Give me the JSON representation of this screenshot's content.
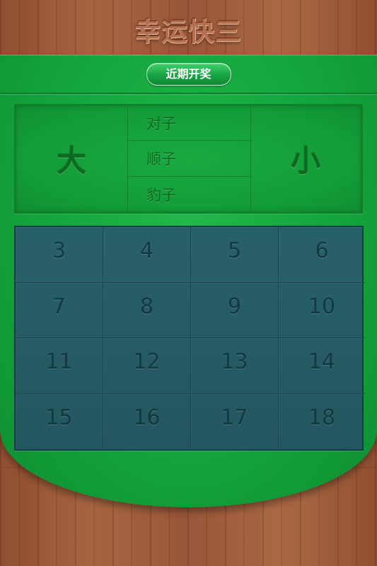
{
  "app": {
    "title": "幸运快三"
  },
  "header": {
    "recent_draws_label": "近期开奖"
  },
  "bets": {
    "big_label": "大",
    "small_label": "小",
    "middle": [
      {
        "label": "对子"
      },
      {
        "label": "顺子"
      },
      {
        "label": "豹子"
      }
    ]
  },
  "numbers": [
    "3",
    "4",
    "5",
    "6",
    "7",
    "8",
    "9",
    "10",
    "11",
    "12",
    "13",
    "14",
    "15",
    "16",
    "17",
    "18"
  ],
  "colors": {
    "felt_green": "#14a43c",
    "grid_teal": "#24565f",
    "wood_brown": "#9a5a37"
  }
}
